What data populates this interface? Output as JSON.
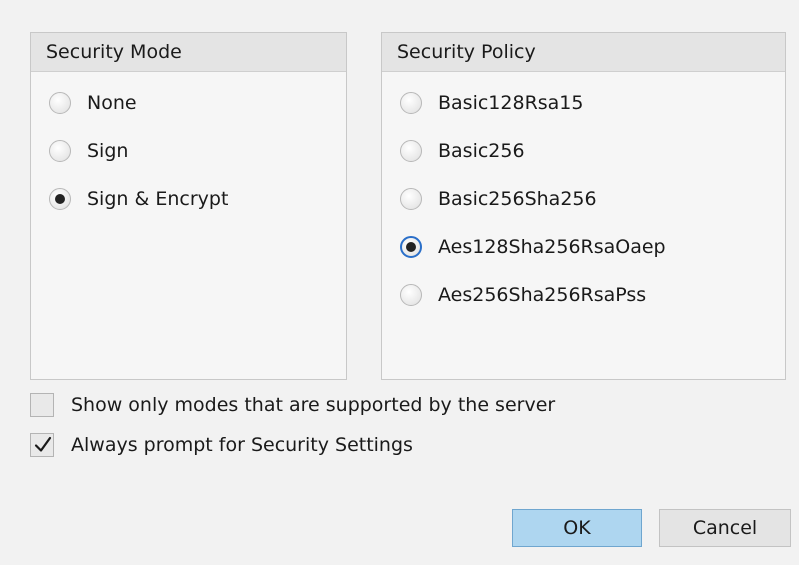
{
  "security_mode": {
    "title": "Security Mode",
    "options": [
      {
        "label": "None",
        "selected": false
      },
      {
        "label": "Sign",
        "selected": false
      },
      {
        "label": "Sign & Encrypt",
        "selected": true
      }
    ]
  },
  "security_policy": {
    "title": "Security Policy",
    "options": [
      {
        "label": "Basic128Rsa15",
        "selected": false
      },
      {
        "label": "Basic256",
        "selected": false
      },
      {
        "label": "Basic256Sha256",
        "selected": false
      },
      {
        "label": "Aes128Sha256RsaOaep",
        "selected": true
      },
      {
        "label": "Aes256Sha256RsaPss",
        "selected": false
      }
    ]
  },
  "checkboxes": {
    "show_supported": {
      "label": "Show only modes that are supported by the server",
      "checked": false
    },
    "always_prompt": {
      "label": "Always prompt for Security Settings",
      "checked": true
    }
  },
  "buttons": {
    "ok": "OK",
    "cancel": "Cancel"
  },
  "colors": {
    "ok_button": "#aed6f0",
    "focus_ring": "#2a6fc9"
  }
}
